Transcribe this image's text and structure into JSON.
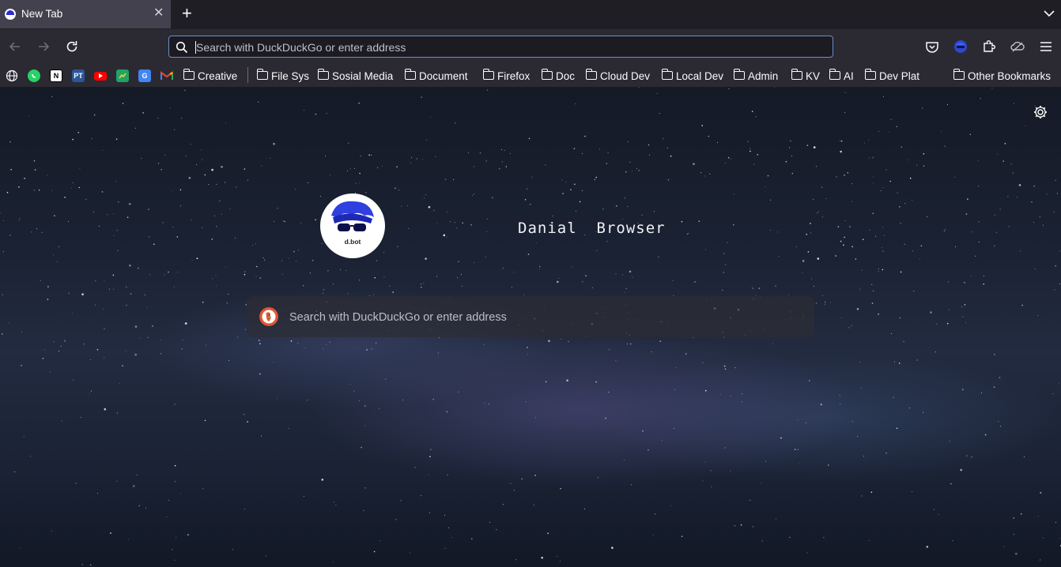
{
  "tab": {
    "title": "New Tab",
    "close_glyph": "✕"
  },
  "tabstrip": {
    "new_tab_glyph": "+"
  },
  "urlbar": {
    "placeholder": "Search with DuckDuckGo or enter address"
  },
  "bookmarks": {
    "favicons": [
      {
        "name": "globe-icon"
      },
      {
        "name": "whatsapp-icon",
        "color": "#25d366"
      },
      {
        "name": "notion-icon",
        "label": "N"
      },
      {
        "name": "pt-icon",
        "label": "PT",
        "color": "#2b5797"
      },
      {
        "name": "youtube-icon",
        "color": "#ff0000"
      },
      {
        "name": "google-sheets-icon",
        "color": "#1fa463"
      },
      {
        "name": "google-translate-icon",
        "label": "G",
        "color": "#4285f4"
      },
      {
        "name": "gmail-icon",
        "label": "M"
      }
    ],
    "folders": [
      "Creative",
      "File Sys",
      "Sosial Media",
      "Document",
      "Firefox",
      "Doc",
      "Cloud Dev",
      "Local Dev",
      "Admin",
      "KV",
      "AI",
      "Dev Plat"
    ],
    "other": "Other Bookmarks"
  },
  "newtab": {
    "logo_text": "d.bot",
    "title": "Danial  Browser",
    "search_placeholder": "Search with DuckDuckGo or enter address"
  },
  "colors": {
    "accent_border": "#6b8ec7",
    "duckduckgo": "#de5833"
  }
}
